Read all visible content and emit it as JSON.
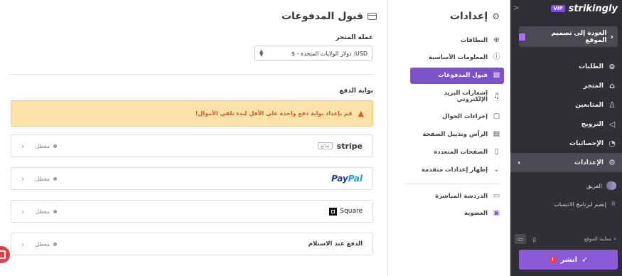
{
  "sidebar": {
    "logo": "strikingly",
    "vip_badge": "VIP",
    "back_button": "العودة إلى تصميم الموقع",
    "nav": [
      {
        "label": "الطلبات",
        "icon": "dollar-circle-icon"
      },
      {
        "label": "المتجر",
        "icon": "store-icon"
      },
      {
        "label": "المتابعين",
        "icon": "followers-icon"
      },
      {
        "label": "الترويج",
        "icon": "megaphone-icon"
      },
      {
        "label": "الإحصائيات",
        "icon": "pie-chart-icon"
      },
      {
        "label": "الإعدادات",
        "icon": "gear-icon",
        "active": true
      }
    ],
    "team": "الفريق",
    "affiliate": "إنضم لبرنامج الانتساب",
    "preview_label": "معاينة الموقع",
    "publish_button": "انشر"
  },
  "settings_menu": {
    "title": "إعدادات",
    "items": [
      {
        "label": "النطاقات",
        "icon": "globe-icon"
      },
      {
        "label": "المعلومات الأساسية",
        "icon": "info-icon"
      },
      {
        "label": "قبول المدفوعات",
        "icon": "card-icon",
        "active": true
      },
      {
        "label": "إشعارات البريد الإلكتروني",
        "icon": "bell-icon"
      },
      {
        "label": "إجراءات الجوال",
        "icon": "mobile-icon"
      },
      {
        "label": "الرأس وتذييل الصفحة",
        "icon": "header-footer-icon"
      },
      {
        "label": "الصفحات المتعددة",
        "icon": "pages-icon"
      },
      {
        "label": "إظهار إعدادات متقدمة",
        "icon": "chevron-down-icon"
      }
    ],
    "extra": [
      {
        "label": "الدردشة المباشرة",
        "icon": "chat-icon"
      },
      {
        "label": "العضوية",
        "icon": "membership-icon"
      }
    ]
  },
  "main": {
    "title": "قبول المدفوعات",
    "currency_label": "عملة المتجر",
    "currency_value": "USD: دولار الولايات المتحدة - $",
    "gateway_label": "بوابة الدفع",
    "alert": "قم بإعداد بوابة دفع واحدة على الأقل لبدء تلقي الأموال!",
    "gateways": [
      {
        "name": "stripe",
        "tag": "شائع",
        "status": "معطل"
      },
      {
        "name": "PayPal",
        "status": "معطل"
      },
      {
        "name": "Square",
        "status": "معطل"
      },
      {
        "name": "الدفع عند الاستلام",
        "status": "معطل"
      }
    ]
  }
}
